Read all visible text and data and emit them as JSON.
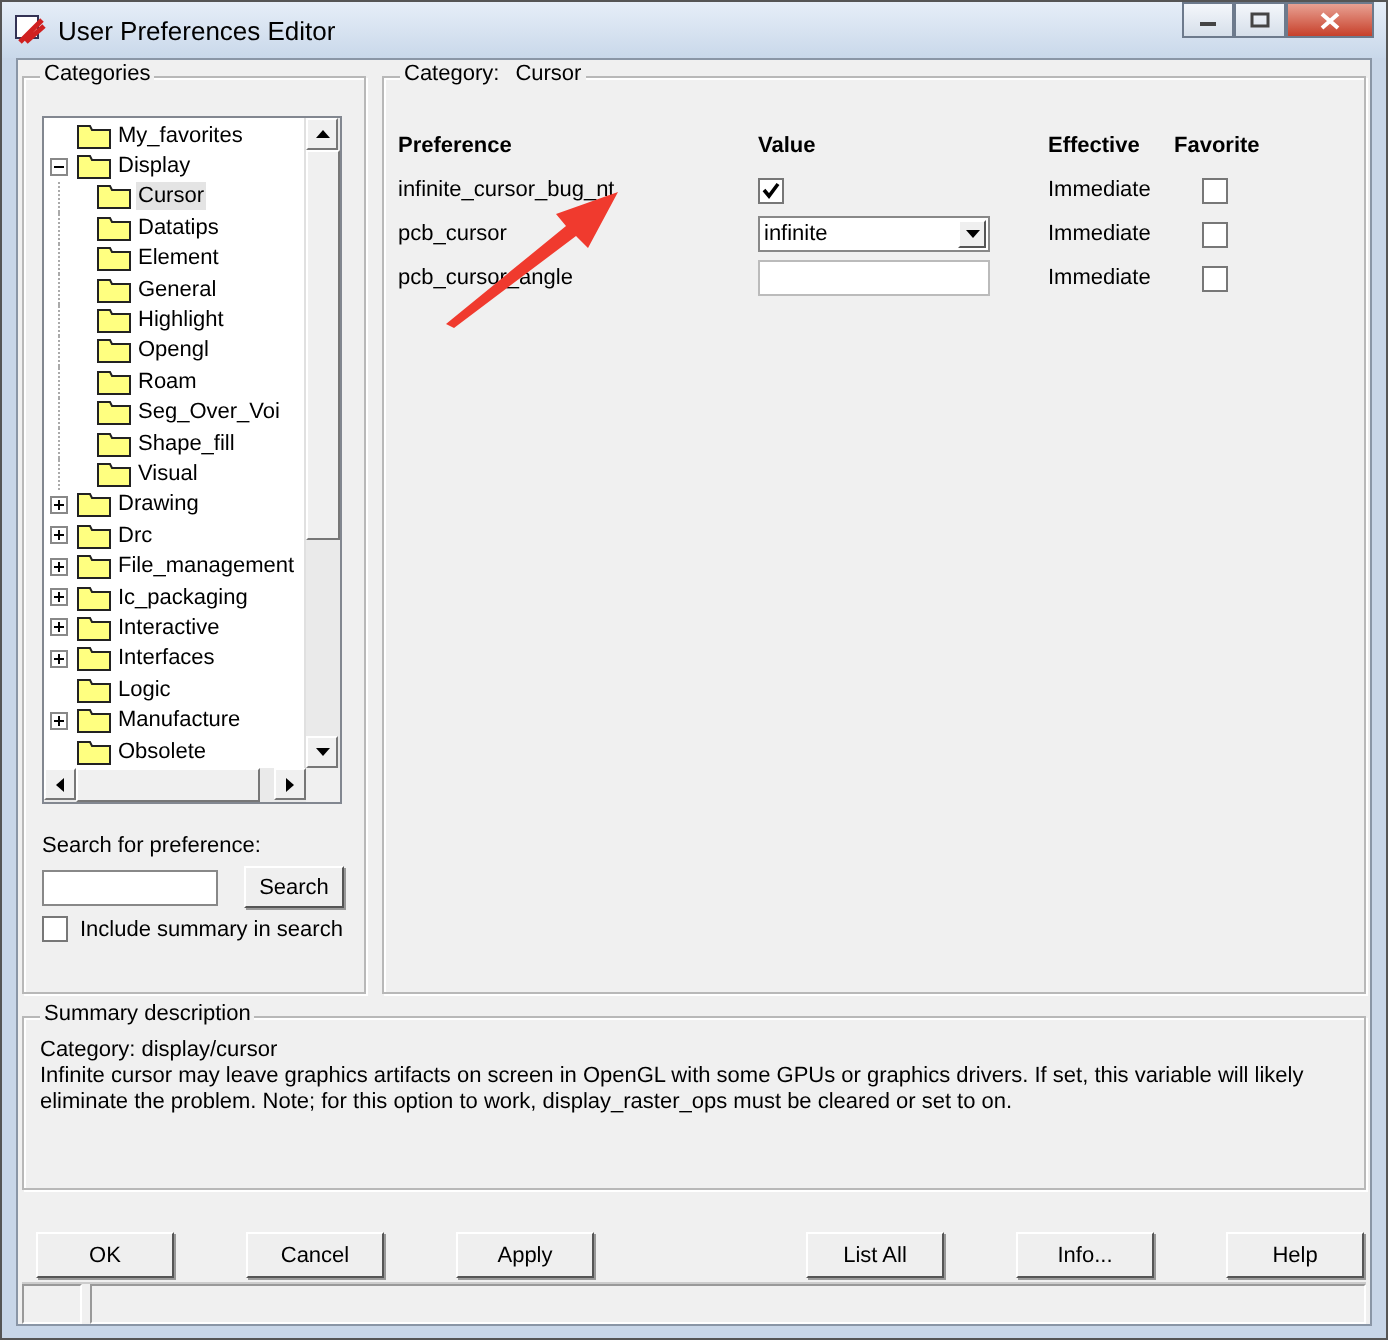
{
  "window": {
    "title": "User Preferences Editor"
  },
  "categories": {
    "title": "Categories",
    "tree": [
      {
        "label": "My_favorites",
        "kind": "leaf",
        "selected": false
      },
      {
        "label": "Display",
        "kind": "folder",
        "expanded": true,
        "selected": false,
        "children": [
          {
            "label": "Cursor",
            "selected": true
          },
          {
            "label": "Datatips",
            "selected": false
          },
          {
            "label": "Element",
            "selected": false
          },
          {
            "label": "General",
            "selected": false
          },
          {
            "label": "Highlight",
            "selected": false
          },
          {
            "label": "Opengl",
            "selected": false
          },
          {
            "label": "Roam",
            "selected": false
          },
          {
            "label": "Seg_Over_Voi",
            "selected": false
          },
          {
            "label": "Shape_fill",
            "selected": false
          },
          {
            "label": "Visual",
            "selected": false
          }
        ]
      },
      {
        "label": "Drawing",
        "kind": "folder",
        "expanded": false,
        "selected": false
      },
      {
        "label": "Drc",
        "kind": "folder",
        "expanded": false,
        "selected": false
      },
      {
        "label": "File_management",
        "kind": "folder",
        "expanded": false,
        "selected": false
      },
      {
        "label": "Ic_packaging",
        "kind": "folder",
        "expanded": false,
        "selected": false
      },
      {
        "label": "Interactive",
        "kind": "folder",
        "expanded": false,
        "selected": false
      },
      {
        "label": "Interfaces",
        "kind": "folder",
        "expanded": false,
        "selected": false
      },
      {
        "label": "Logic",
        "kind": "leaf",
        "selected": false
      },
      {
        "label": "Manufacture",
        "kind": "folder",
        "expanded": false,
        "selected": false
      },
      {
        "label": "Obsolete",
        "kind": "leaf",
        "selected": false
      }
    ]
  },
  "search": {
    "label": "Search for preference:",
    "button": "Search",
    "include_summary": {
      "label": "Include summary in search",
      "checked": false
    }
  },
  "preferences": {
    "title_label": "Category:",
    "title_value": "Cursor",
    "columns": [
      "Preference",
      "Value",
      "Effective",
      "Favorite"
    ],
    "rows": [
      {
        "name": "infinite_cursor_bug_nt",
        "kind": "checkbox",
        "checked": true,
        "effective": "Immediate",
        "favorite": false
      },
      {
        "name": "pcb_cursor",
        "kind": "dropdown",
        "value": "infinite",
        "effective": "Immediate",
        "favorite": false
      },
      {
        "name": "pcb_cursor_angle",
        "kind": "text",
        "effective": "Immediate",
        "favorite": false
      }
    ]
  },
  "summary": {
    "title": "Summary description",
    "category": "Category: display/cursor",
    "text": "Infinite cursor may leave graphics artifacts on screen in OpenGL with some GPUs or graphics drivers. If set, this variable will likely eliminate the problem. Note; for this option to work, display_raster_ops must be cleared or set to on."
  },
  "buttons_left": [
    "OK",
    "Cancel",
    "Apply"
  ],
  "buttons_right": [
    "List All",
    "Info...",
    "Help"
  ]
}
